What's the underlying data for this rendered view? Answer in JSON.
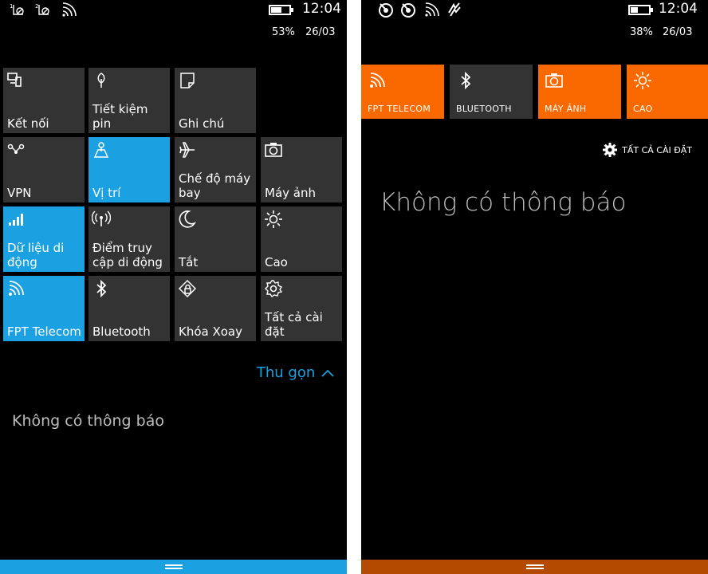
{
  "colors": {
    "accent_blue": "#1ba1e2",
    "accent_orange": "#fa6800",
    "tile_off": "#333333",
    "background": "#000000"
  },
  "left": {
    "status": {
      "icons": [
        "sim1-signal-icon",
        "sim2-signal-icon",
        "wifi-icon"
      ],
      "time": "12:04",
      "battery_percent": "53%",
      "date": "26/03",
      "battery_level": 0.53
    },
    "tiles": [
      {
        "label": "Kết nối",
        "icon": "connect-icon",
        "active": false
      },
      {
        "label": "Tiết kiệm pin",
        "icon": "battery-saver-icon",
        "active": false
      },
      {
        "label": "Ghi chú",
        "icon": "note-icon",
        "active": false
      },
      {
        "label": "VPN",
        "icon": "vpn-icon",
        "active": false
      },
      {
        "label": "Vị trí",
        "icon": "location-icon",
        "active": true
      },
      {
        "label": "Chế độ máy bay",
        "icon": "airplane-icon",
        "active": false
      },
      {
        "label": "Máy ảnh",
        "icon": "camera-icon",
        "active": false
      },
      {
        "label": "Dữ liệu di động",
        "icon": "cellular-data-icon",
        "active": true
      },
      {
        "label": "Điểm truy cập di động",
        "icon": "hotspot-icon",
        "active": false
      },
      {
        "label": "Tắt",
        "icon": "quiet-hours-icon",
        "active": false
      },
      {
        "label": "Cao",
        "icon": "brightness-icon",
        "active": false
      },
      {
        "label": "FPT Telecom",
        "icon": "wifi-icon",
        "active": true
      },
      {
        "label": "Bluetooth",
        "icon": "bluetooth-icon",
        "active": false
      },
      {
        "label": "Khóa Xoay",
        "icon": "rotation-lock-icon",
        "active": false
      },
      {
        "label": "Tất cả cài đặt",
        "icon": "settings-icon",
        "active": false
      }
    ],
    "collapse_label": "Thu gọn",
    "no_notifications": "Không có thông báo",
    "navbar_color": "#1ba1e2"
  },
  "right": {
    "status": {
      "icons": [
        "sim1-icon",
        "sim2-icon",
        "wifi-icon",
        "data-sync-icon"
      ],
      "time": "12:04",
      "battery_percent": "38%",
      "date": "26/03",
      "battery_level": 0.38
    },
    "quick_tiles": [
      {
        "label": "FPT TELECOM",
        "icon": "wifi-icon",
        "active": true
      },
      {
        "label": "BLUETOOTH",
        "icon": "bluetooth-icon",
        "active": false
      },
      {
        "label": "MÁY ẢNH",
        "icon": "camera-icon",
        "active": true
      },
      {
        "label": "CAO",
        "icon": "brightness-icon",
        "active": true
      }
    ],
    "all_settings_label": "TẤT CẢ CÀI ĐẶT",
    "no_notifications": "Không có thông báo",
    "navbar_color": "#b34a00"
  }
}
